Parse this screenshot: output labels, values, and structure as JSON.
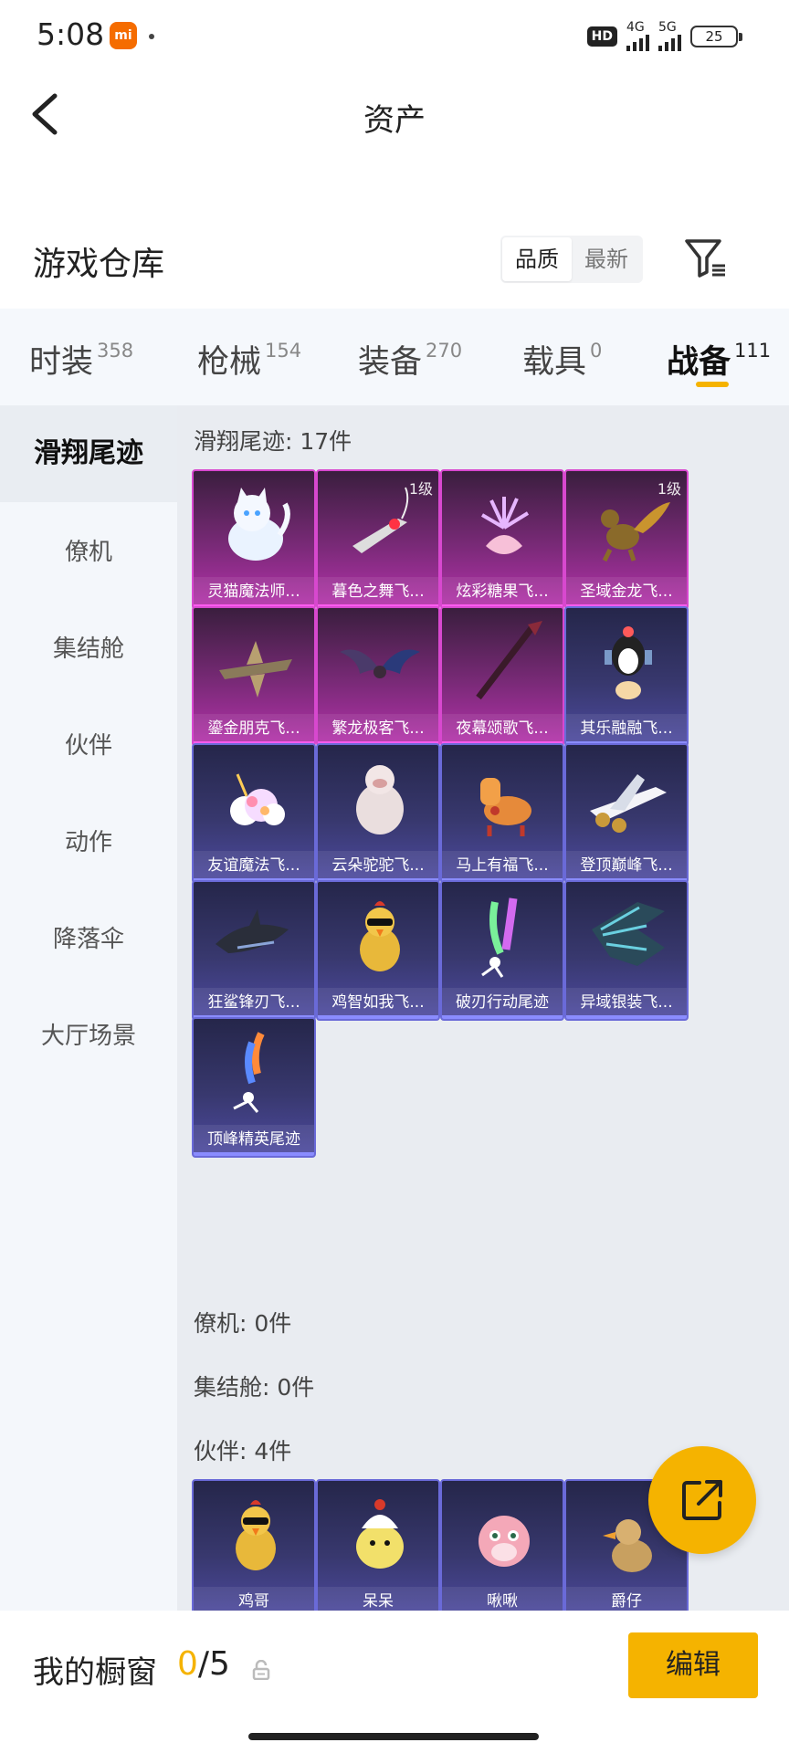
{
  "status_bar": {
    "time": "5:08",
    "mi_badge": "mi",
    "hd": "HD",
    "net1": "4G",
    "net2": "5G",
    "battery": "25"
  },
  "nav": {
    "title": "资产"
  },
  "warehouse": {
    "title": "游戏仓库",
    "sort_options": [
      "品质",
      "最新"
    ],
    "selected_sort": "品质"
  },
  "tabs": [
    {
      "label": "时装",
      "count": "358"
    },
    {
      "label": "枪械",
      "count": "154"
    },
    {
      "label": "装备",
      "count": "270"
    },
    {
      "label": "载具",
      "count": "0"
    },
    {
      "label": "战备",
      "count": "111",
      "active": true
    }
  ],
  "sidebar": {
    "items": [
      "滑翔尾迹",
      "僚机",
      "集结舱",
      "伙伴",
      "动作",
      "降落伞",
      "大厅场景"
    ],
    "active": "滑翔尾迹"
  },
  "sections": [
    {
      "label": "滑翔尾迹: 17件"
    },
    {
      "label": "僚机: 0件"
    },
    {
      "label": "集结舱: 0件"
    },
    {
      "label": "伙伴: 4件"
    }
  ],
  "glide_items": [
    {
      "name": "灵猫魔法师...",
      "rarity": "pink",
      "badge": "",
      "icon": "cat-icon"
    },
    {
      "name": "暮色之舞飞...",
      "rarity": "pink",
      "badge": "1级",
      "icon": "dagger-icon"
    },
    {
      "name": "炫彩糖果飞...",
      "rarity": "pink",
      "badge": "",
      "icon": "candy-icon"
    },
    {
      "name": "圣域金龙飞...",
      "rarity": "pink",
      "badge": "1级",
      "icon": "dragon-icon"
    },
    {
      "name": "鎏金朋克飞...",
      "rarity": "pink",
      "badge": "",
      "icon": "aircraft-icon"
    },
    {
      "name": "繁龙极客飞...",
      "rarity": "pink",
      "badge": "",
      "icon": "bat-icon"
    },
    {
      "name": "夜幕颂歌飞...",
      "rarity": "pink",
      "badge": "",
      "icon": "spear-icon"
    },
    {
      "name": "其乐融融飞...",
      "rarity": "purple",
      "badge": "",
      "icon": "penguin-icon"
    },
    {
      "name": "友谊魔法飞...",
      "rarity": "purple",
      "badge": "",
      "icon": "cloud-icon"
    },
    {
      "name": "云朵驼驼飞...",
      "rarity": "purple",
      "badge": "",
      "icon": "alpaca-icon"
    },
    {
      "name": "马上有福飞...",
      "rarity": "purple",
      "badge": "",
      "icon": "horse-icon"
    },
    {
      "name": "登顶巅峰飞...",
      "rarity": "purple",
      "badge": "",
      "icon": "jet-icon"
    },
    {
      "name": "狂鲨锋刃飞...",
      "rarity": "purple",
      "badge": "",
      "icon": "shark-icon"
    },
    {
      "name": "鸡智如我飞...",
      "rarity": "purple",
      "badge": "",
      "icon": "chicken-icon"
    },
    {
      "name": "破刃行动尾迹",
      "rarity": "purple",
      "badge": "",
      "icon": "smoke-trail-icon"
    },
    {
      "name": "异域银装飞...",
      "rarity": "purple",
      "badge": "",
      "icon": "mech-wing-icon"
    },
    {
      "name": "顶峰精英尾迹",
      "rarity": "purple",
      "badge": "",
      "icon": "flame-trail-icon"
    }
  ],
  "partner_items": [
    {
      "name": "鸡哥",
      "rarity": "purple",
      "icon": "chicken-icon"
    },
    {
      "name": "呆呆",
      "rarity": "purple",
      "icon": "chick-icon"
    },
    {
      "name": "啾啾",
      "rarity": "purple",
      "icon": "bird-icon"
    },
    {
      "name": "爵仔",
      "rarity": "purple",
      "icon": "duck-icon"
    }
  ],
  "bottom": {
    "showcase_label": "我的橱窗",
    "current": "0",
    "total": "/5",
    "edit_label": "编辑"
  },
  "colors": {
    "accent": "#f5b300",
    "rare_pink": "#b532ab",
    "rare_purple": "#4d4aa0"
  }
}
